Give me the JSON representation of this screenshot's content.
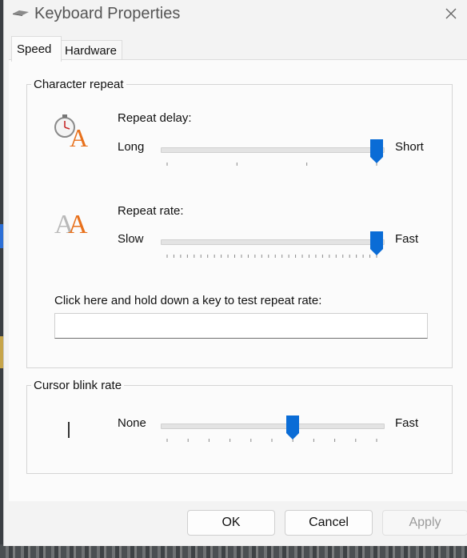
{
  "window": {
    "title": "Keyboard Properties"
  },
  "tabs": {
    "speed": "Speed",
    "hardware": "Hardware"
  },
  "character_repeat": {
    "group_label": "Character repeat",
    "repeat_delay": {
      "label": "Repeat delay:",
      "min_label": "Long",
      "max_label": "Short",
      "value": 3,
      "max": 3
    },
    "repeat_rate": {
      "label": "Repeat rate:",
      "min_label": "Slow",
      "max_label": "Fast",
      "value": 31,
      "max": 31
    },
    "test_prompt": "Click here and hold down a key to test repeat rate:",
    "test_value": ""
  },
  "cursor_blink": {
    "group_label": "Cursor blink rate",
    "min_label": "None",
    "max_label": "Fast",
    "value": 6,
    "max": 10
  },
  "buttons": {
    "ok": "OK",
    "cancel": "Cancel",
    "apply": "Apply"
  },
  "icons": {
    "app": "keyboard-icon",
    "close": "close-icon",
    "delay": "stopwatch-letter-a-icon",
    "rate": "double-letter-a-icon",
    "cursor": "text-cursor-icon"
  },
  "colors": {
    "slider_thumb": "#0a6cd6",
    "letter_orange": "#e8711c",
    "letter_gray": "#b8b8b8"
  }
}
